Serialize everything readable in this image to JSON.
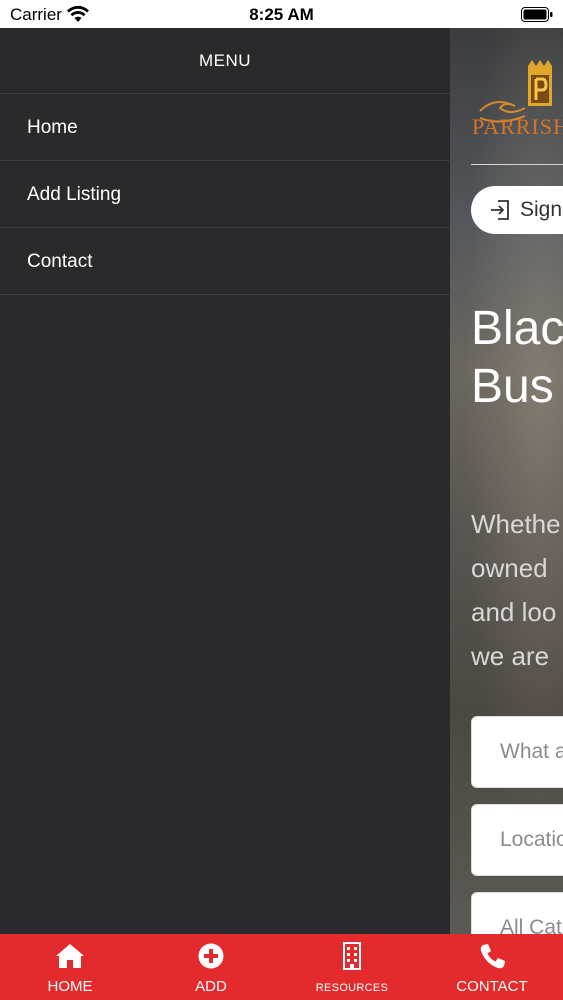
{
  "status_bar": {
    "carrier": "Carrier",
    "time": "8:25 AM"
  },
  "drawer": {
    "title": "MENU",
    "items": [
      {
        "label": "Home"
      },
      {
        "label": "Add Listing"
      },
      {
        "label": "Contact"
      }
    ]
  },
  "main": {
    "logo_text": "PARRISH",
    "signin_label": "Sign",
    "headline_line1": "Blac",
    "headline_line2": "Bus",
    "description_lines": [
      "Whethe",
      "owned",
      "and loo",
      "we are"
    ],
    "search_placeholder": "What a",
    "location_placeholder": "Locatio",
    "category_placeholder": "All Cate"
  },
  "tabbar": {
    "background_color": "#e32a2d",
    "tabs": [
      {
        "label": "HOME",
        "icon": "home-icon"
      },
      {
        "label": "ADD",
        "icon": "plus-circle-icon"
      },
      {
        "label": "RESOURCES",
        "icon": "building-icon"
      },
      {
        "label": "CONTACT",
        "icon": "phone-icon"
      }
    ]
  }
}
